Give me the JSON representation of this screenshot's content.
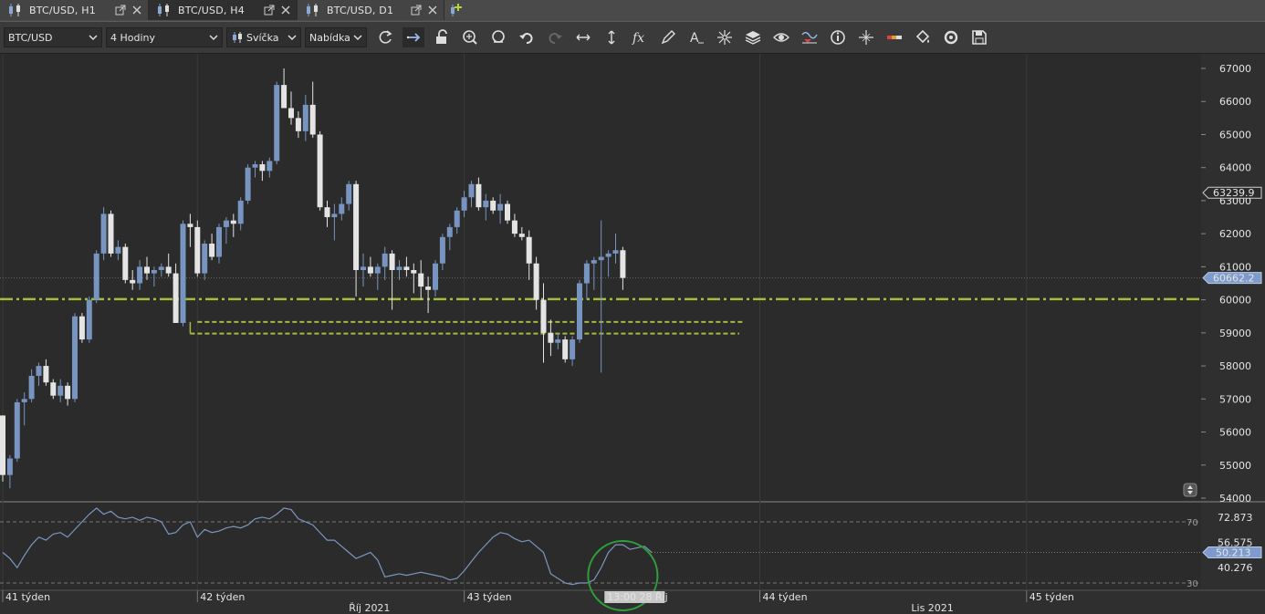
{
  "tabs": [
    {
      "label": "BTC/USD, H1",
      "active": false
    },
    {
      "label": "BTC/USD, H4",
      "active": true
    },
    {
      "label": "BTC/USD, D1",
      "active": false
    }
  ],
  "toolbar": {
    "symbol": "BTC/USD",
    "timeframe": "4 Hodiny",
    "chart_type": "Svíčka",
    "menu": "Nabídka",
    "icons": [
      "refresh-icon",
      "autoscroll-icon",
      "unlock-icon",
      "zoom-in-icon",
      "zoom-out-icon",
      "undo-icon",
      "redo-icon",
      "horizontal-scale-icon",
      "vertical-scale-icon",
      "function-icon",
      "pencil-icon",
      "text-icon",
      "crosshair-icon",
      "layers-icon",
      "eye-icon",
      "indicator-icon",
      "info-icon",
      "cursor-cross-icon",
      "color-bar-icon",
      "paint-bucket-icon",
      "cycle-icon",
      "save-icon"
    ]
  },
  "colors": {
    "bull": "#7894c0",
    "bear": "#e4e4e4",
    "support_line": "#a4bd3c",
    "rsi_line": "#7d96c1",
    "price_tag_bg": "#7f9bcb",
    "circle": "#2f9e3d"
  },
  "chart_data": {
    "type": "candlestick",
    "symbol": "BTC/USD",
    "timeframe": "H4",
    "y_ticks": [
      67000,
      66000,
      65000,
      64000,
      63000,
      62000,
      61000,
      60000,
      59000,
      58000,
      57000,
      56000,
      55000,
      54000
    ],
    "ylim": [
      54000,
      67300
    ],
    "price_tags": [
      {
        "text": "63239.9",
        "value": 63239.9,
        "style": "outline"
      },
      {
        "text": "60662.2",
        "value": 60662.2,
        "style": "filled"
      }
    ],
    "candles": [
      [
        56500,
        56500,
        54500,
        54700
      ],
      [
        54700,
        55300,
        54300,
        55200
      ],
      [
        55200,
        57000,
        55100,
        56900
      ],
      [
        56900,
        57200,
        56200,
        57000
      ],
      [
        57000,
        57900,
        56900,
        57700
      ],
      [
        57700,
        58100,
        57400,
        58000
      ],
      [
        58000,
        58200,
        57400,
        57500
      ],
      [
        57500,
        57600,
        57000,
        57100
      ],
      [
        57100,
        57600,
        56900,
        57400
      ],
      [
        57400,
        57500,
        56800,
        57000
      ],
      [
        57000,
        59600,
        56900,
        59500
      ],
      [
        59500,
        59600,
        58700,
        58800
      ],
      [
        58800,
        60100,
        58700,
        60000
      ],
      [
        60000,
        61500,
        59900,
        61400
      ],
      [
        61400,
        62800,
        61200,
        62600
      ],
      [
        62600,
        62700,
        61300,
        61400
      ],
      [
        61400,
        61800,
        61200,
        61600
      ],
      [
        61600,
        61700,
        60500,
        60600
      ],
      [
        60600,
        60900,
        60300,
        60500
      ],
      [
        60500,
        61200,
        60300,
        61000
      ],
      [
        61000,
        61300,
        60600,
        60800
      ],
      [
        60800,
        61000,
        60400,
        60900
      ],
      [
        60900,
        61100,
        60700,
        61000
      ],
      [
        61000,
        61400,
        60700,
        60800
      ],
      [
        60800,
        61100,
        59300,
        59300
      ],
      [
        59300,
        62400,
        59200,
        62300
      ],
      [
        62300,
        62600,
        61600,
        62200
      ],
      [
        62200,
        62400,
        60700,
        60800
      ],
      [
        60800,
        61800,
        60600,
        61700
      ],
      [
        61700,
        62000,
        61200,
        61300
      ],
      [
        61300,
        62300,
        61100,
        62200
      ],
      [
        62200,
        62500,
        61700,
        62400
      ],
      [
        62400,
        62600,
        61900,
        62300
      ],
      [
        62300,
        63100,
        62100,
        63000
      ],
      [
        63000,
        64100,
        62900,
        64000
      ],
      [
        64000,
        64200,
        63700,
        64100
      ],
      [
        64100,
        64200,
        63600,
        63900
      ],
      [
        63900,
        64300,
        63700,
        64200
      ],
      [
        64200,
        66600,
        64100,
        66500
      ],
      [
        66500,
        67000,
        65900,
        65800
      ],
      [
        65800,
        66300,
        65300,
        65500
      ],
      [
        65500,
        65700,
        64900,
        65100
      ],
      [
        65100,
        66200,
        64800,
        65900
      ],
      [
        65900,
        66600,
        64900,
        65000
      ],
      [
        65000,
        65100,
        62700,
        62800
      ],
      [
        62800,
        63000,
        62200,
        62500
      ],
      [
        62500,
        62900,
        61800,
        62600
      ],
      [
        62600,
        63100,
        62400,
        62900
      ],
      [
        62900,
        63600,
        62700,
        63500
      ],
      [
        63500,
        63600,
        60100,
        60900
      ],
      [
        60900,
        61400,
        60400,
        61000
      ],
      [
        61000,
        61300,
        60700,
        60800
      ],
      [
        60800,
        61100,
        60300,
        61000
      ],
      [
        61000,
        61600,
        60600,
        61400
      ],
      [
        61400,
        61500,
        59700,
        60900
      ],
      [
        60900,
        61200,
        60600,
        61000
      ],
      [
        61000,
        61300,
        60700,
        60900
      ],
      [
        60900,
        61100,
        60200,
        60800
      ],
      [
        60800,
        61200,
        60000,
        60400
      ],
      [
        60400,
        60700,
        59600,
        60300
      ],
      [
        60300,
        61200,
        60100,
        61100
      ],
      [
        61100,
        62000,
        60900,
        61900
      ],
      [
        61900,
        62300,
        61500,
        62200
      ],
      [
        62200,
        62800,
        62000,
        62700
      ],
      [
        62700,
        63300,
        62500,
        63100
      ],
      [
        63100,
        63600,
        62800,
        63500
      ],
      [
        63500,
        63700,
        62700,
        62800
      ],
      [
        62800,
        63200,
        62400,
        63000
      ],
      [
        63000,
        63100,
        62600,
        62700
      ],
      [
        62700,
        63200,
        62300,
        62900
      ],
      [
        62900,
        63000,
        62300,
        62400
      ],
      [
        62400,
        62600,
        61900,
        62000
      ],
      [
        62000,
        62200,
        61800,
        61900
      ],
      [
        61900,
        62100,
        60600,
        61100
      ],
      [
        61100,
        61300,
        59700,
        60000
      ],
      [
        60000,
        60500,
        58100,
        59000
      ],
      [
        59000,
        59400,
        58300,
        58700
      ],
      [
        58700,
        59000,
        58500,
        58800
      ],
      [
        58800,
        58900,
        58100,
        58200
      ],
      [
        58200,
        58900,
        58000,
        58800
      ],
      [
        58800,
        60600,
        58700,
        60500
      ],
      [
        60500,
        61200,
        60000,
        61100
      ],
      [
        61100,
        61300,
        60300,
        61200
      ],
      [
        61200,
        62400,
        57800,
        61300
      ],
      [
        61300,
        61500,
        60700,
        61400
      ],
      [
        61400,
        62000,
        61100,
        61500
      ],
      [
        61500,
        61600,
        60300,
        60662
      ]
    ],
    "support_lines": [
      {
        "value": 60020,
        "style": "dash-dot"
      },
      {
        "value": 59330,
        "style": "dashed",
        "start_candle": 27
      },
      {
        "value": 58980,
        "style": "dashed",
        "start_candle": 26
      }
    ],
    "x_labels": [
      {
        "text": "41 týden",
        "candle": 0
      },
      {
        "text": "42 týden",
        "candle": 27
      },
      {
        "text": "43 týden",
        "candle": 64
      },
      {
        "text": "44 týden",
        "candle": 105
      },
      {
        "text": "45 týden",
        "candle": 142
      }
    ],
    "month_labels": [
      {
        "text": "Říj 2021",
        "candle": 48
      },
      {
        "text": "Lis 2021",
        "candle": 126
      }
    ],
    "time_tag": "13:00 28 Říj",
    "rsi": {
      "levels": [
        70,
        30
      ],
      "level_labels": [
        "70",
        "30"
      ],
      "scale_labels": [
        "72.873",
        "56.575",
        "40.276"
      ],
      "current_tag": "50.213",
      "ylim": [
        24,
        80
      ],
      "values": [
        50,
        46,
        40,
        48,
        55,
        60,
        58,
        62,
        63,
        60,
        65,
        70,
        75,
        79,
        75,
        77,
        73,
        72,
        73,
        71,
        73,
        72,
        70,
        62,
        63,
        68,
        70,
        60,
        65,
        63,
        64,
        66,
        67,
        66,
        68,
        72,
        73,
        72,
        75,
        79,
        78,
        72,
        70,
        68,
        63,
        58,
        58,
        54,
        50,
        46,
        48,
        50,
        45,
        34,
        35,
        36,
        35,
        36,
        37,
        36,
        35,
        34,
        32,
        33,
        38,
        44,
        50,
        55,
        60,
        63,
        62,
        59,
        57,
        58,
        54,
        50,
        36,
        33,
        30,
        29,
        30,
        30,
        32,
        40,
        50,
        55,
        55,
        52,
        53,
        54,
        50
      ]
    }
  }
}
